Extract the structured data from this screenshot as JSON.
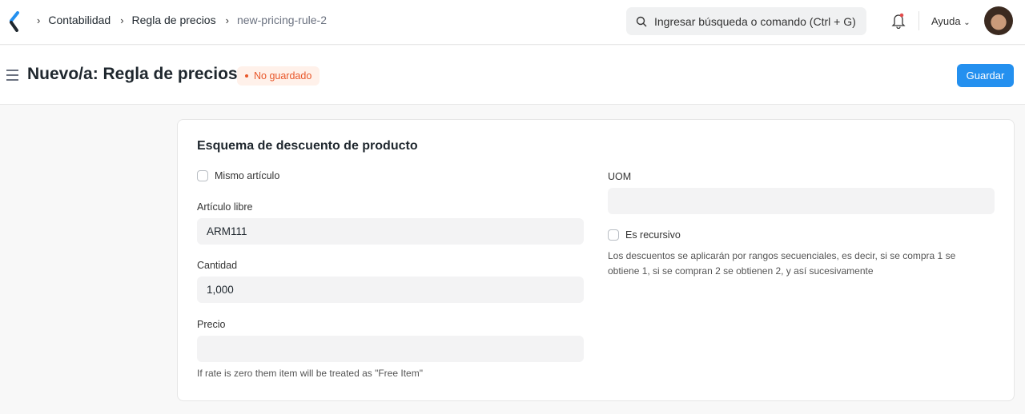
{
  "breadcrumbs": [
    "Contabilidad",
    "Regla de precios",
    "new-pricing-rule-2"
  ],
  "search": {
    "placeholder": "Ingresar búsqueda o comando (Ctrl + G)"
  },
  "nav": {
    "help": "Ayuda"
  },
  "header": {
    "title": "Nuevo/a: Regla de precios",
    "status": "No guardado",
    "save": "Guardar"
  },
  "section": {
    "title": "Esquema de descuento de producto",
    "same_item": "Mismo artículo",
    "free_item_label": "Artículo libre",
    "free_item_value": "ARM111",
    "qty_label": "Cantidad",
    "qty_value": "1,000",
    "rate_label": "Precio",
    "rate_value": "",
    "rate_help": "If rate is zero them item will be treated as \"Free Item\"",
    "uom_label": "UOM",
    "uom_value": "",
    "recursive": "Es recursivo",
    "recursive_help": "Los descuentos se aplicarán por rangos secuenciales, es decir, si se compra 1 se obtiene 1, si se compran 2 se obtienen 2, y así sucesivamente"
  },
  "colors": {
    "primary": "#2490ef",
    "warning": "#e8572a"
  }
}
